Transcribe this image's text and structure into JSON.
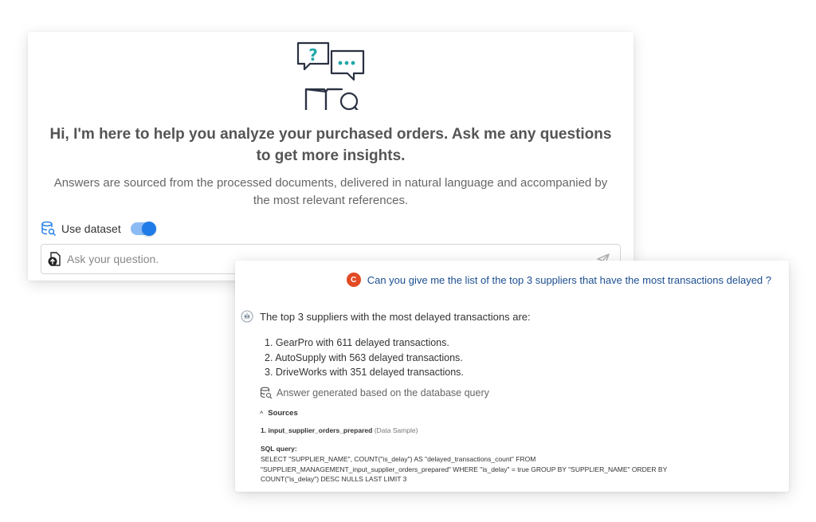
{
  "welcome": {
    "greeting": "Hi, I'm here to help you analyze your purchased orders. Ask me any questions to get more insights.",
    "subtitle": "Answers are sourced from the processed documents, delivered in natural language and accompanied by the most relevant references.",
    "illustration_icons": [
      "question-bubble-icon",
      "dots-bubble-icon",
      "book-search-icon"
    ],
    "accent_color": "#1f7be8"
  },
  "dataset": {
    "label": "Use dataset",
    "enabled": true
  },
  "ask": {
    "placeholder": "Ask your question."
  },
  "conversation": {
    "user": {
      "initial": "C",
      "avatar_color": "#e24a24",
      "question": "Can you give me the list of the top 3 suppliers that have the most transactions delayed ?"
    },
    "answer": {
      "intro": "The top 3 suppliers with the most delayed transactions are:",
      "items": [
        "1. GearPro with 611 delayed transactions.",
        "2. AutoSupply with 563 delayed transactions.",
        "3. DriveWorks with 351 delayed transactions."
      ],
      "basis": "Answer generated based on the database query"
    },
    "sources": {
      "label": "Sources",
      "items": [
        {
          "num": "1.",
          "name": "input_supplier_orders_prepared",
          "tag": "(Data Sample)"
        }
      ],
      "sql_label": "SQL query:",
      "sql_lines": [
        "SELECT \"SUPPLIER_NAME\", COUNT(\"is_delay\") AS \"delayed_transactions_count\" FROM",
        "\"SUPPLIER_MANAGEMENT_input_supplier_orders_prepared\" WHERE \"is_delay\" = true GROUP BY \"SUPPLIER_NAME\" ORDER BY",
        "COUNT(\"is_delay\") DESC NULLS LAST LIMIT 3"
      ]
    }
  }
}
